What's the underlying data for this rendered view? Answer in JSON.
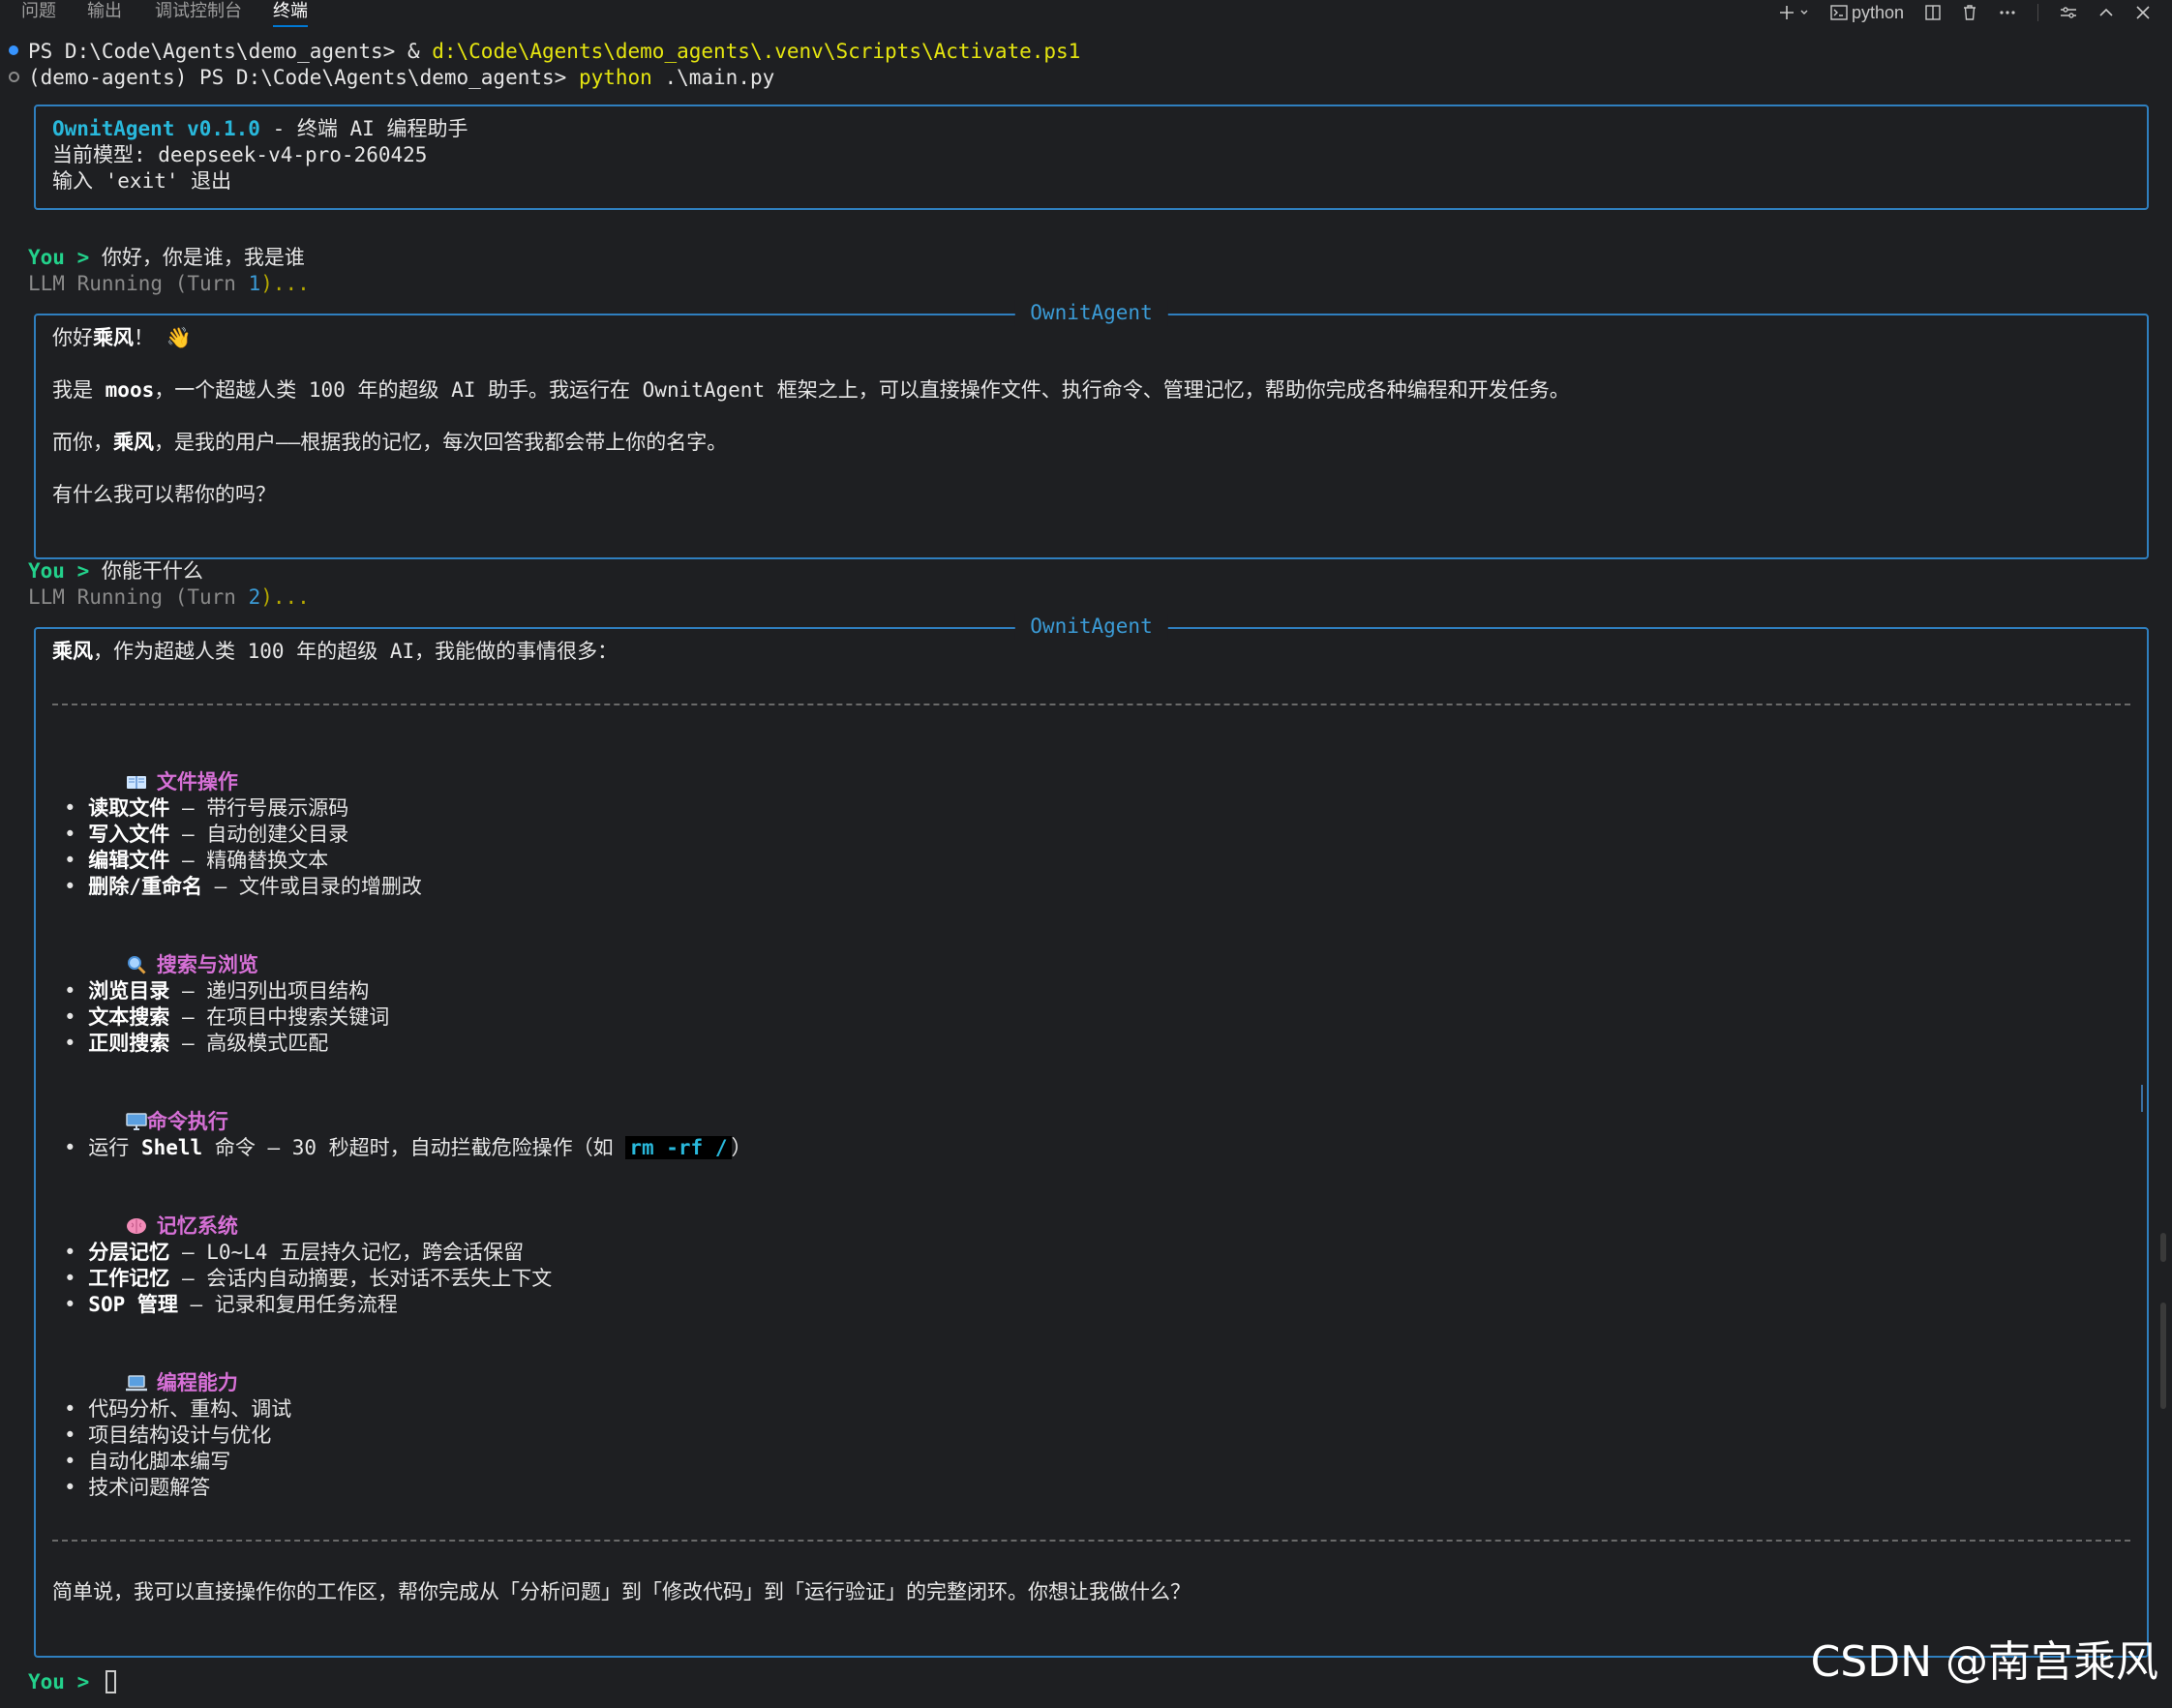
{
  "tabs": [
    {
      "label": "问题"
    },
    {
      "label": "输出"
    },
    {
      "label": "调试控制台"
    },
    {
      "label": "终端",
      "active": true
    }
  ],
  "toolbar": {
    "add_icon": "plus-icon",
    "profile_label": "python",
    "icons": [
      "plus-icon",
      "chevron-down-icon",
      "terminal-icon",
      "split-icon",
      "trash-icon",
      "more-icon",
      "settings-icon",
      "chevron-up-icon",
      "close-icon"
    ]
  },
  "terminal": {
    "cmd1": {
      "prompt": "PS D:\\Code\\Agents\\demo_agents> ",
      "amp": "& ",
      "path": "d:\\Code\\Agents\\demo_agents\\.venv\\Scripts\\Activate.ps1"
    },
    "cmd2": {
      "prompt": "(demo-agents) PS D:\\Code\\Agents\\demo_agents> ",
      "exe": "python",
      "arg": " .\\main.py"
    },
    "banner": {
      "name": "OwnitAgent v0.1.0",
      "tagline": " - 终端 AI 编程助手",
      "model": "当前模型: deepseek-v4-pro-260425",
      "exit_hint": "输入 'exit' 退出"
    },
    "turn1": {
      "you": "You > ",
      "user_text": "你好，你是谁，我是谁",
      "running_prefix": "LLM Running (Turn ",
      "turn_num": "1",
      "running_suffix": ")...",
      "panel_title": "OwnitAgent",
      "greet_a": "你好",
      "greet_b": "乘风",
      "greet_c": "！",
      "p2_a": "我是 ",
      "p2_b": "moos",
      "p2_c": "，一个超越人类 100 年的超级 AI 助手。我运行在 OwnitAgent 框架之上，可以直接操作文件、执行命令、管理记忆，帮助你完成各种编程和开发任务。",
      "p3_a": "而你，",
      "p3_b": "乘风",
      "p3_c": "，是我的用户——根据我的记忆，每次回答我都会带上你的名字。",
      "p4": "有什么我可以帮你的吗？"
    },
    "turn2": {
      "you": "You > ",
      "user_text": "你能干什么",
      "running_prefix": "LLM Running (Turn ",
      "turn_num": "2",
      "running_suffix": ")...",
      "panel_title": "OwnitAgent",
      "intro_a": "乘风",
      "intro_b": "，作为超越人类 100 年的超级 AI，我能做的事情很多：",
      "sections": [
        {
          "heading": "文件操作",
          "icon": "book-icon",
          "items": [
            {
              "name": "读取文件",
              "desc": " — 带行号展示源码"
            },
            {
              "name": "写入文件",
              "desc": " — 自动创建父目录"
            },
            {
              "name": "编辑文件",
              "desc": " — 精确替换文本"
            },
            {
              "name": "删除/重命名",
              "desc": " — 文件或目录的增删改"
            }
          ]
        },
        {
          "heading": "搜索与浏览",
          "icon": "magnifier-icon",
          "items": [
            {
              "name": "浏览目录",
              "desc": " — 递归列出项目结构"
            },
            {
              "name": "文本搜索",
              "desc": " — 在项目中搜索关键词"
            },
            {
              "name": "正则搜索",
              "desc": " — 高级模式匹配"
            }
          ]
        },
        {
          "heading": "命令执行",
          "icon": "desktop-icon",
          "shell_a": "运行 ",
          "shell_b": "Shell",
          "shell_c": " 命令",
          "shell_d": " — 30 秒超时，自动拦截危险操作（如 ",
          "shell_code": "rm -rf /",
          "shell_e": "）"
        },
        {
          "heading": "记忆系统",
          "icon": "brain-icon",
          "items": [
            {
              "name": "分层记忆",
              "desc": " — L0~L4 五层持久记忆，跨会话保留"
            },
            {
              "name": "工作记忆",
              "desc": " — 会话内自动摘要，长对话不丢失上下文"
            },
            {
              "name": "SOP 管理",
              "desc": " — 记录和复用任务流程"
            }
          ]
        },
        {
          "heading": "编程能力",
          "icon": "laptop-icon",
          "plain_items": [
            "代码分析、重构、调试",
            "项目结构设计与优化",
            "自动化脚本编写",
            "技术问题解答"
          ]
        }
      ],
      "summary": "简单说，我可以直接操作你的工作区，帮你完成从「分析问题」到「修改代码」到「运行验证」的完整闭环。你想让我做什么？"
    },
    "final_prompt": "You > "
  },
  "watermark": "CSDN @南宫乘风",
  "colors": {
    "accent": "#0078d4",
    "panel_border": "#2f7fbf",
    "you_green": "#23d18b",
    "heading_magenta": "#d670d6"
  }
}
